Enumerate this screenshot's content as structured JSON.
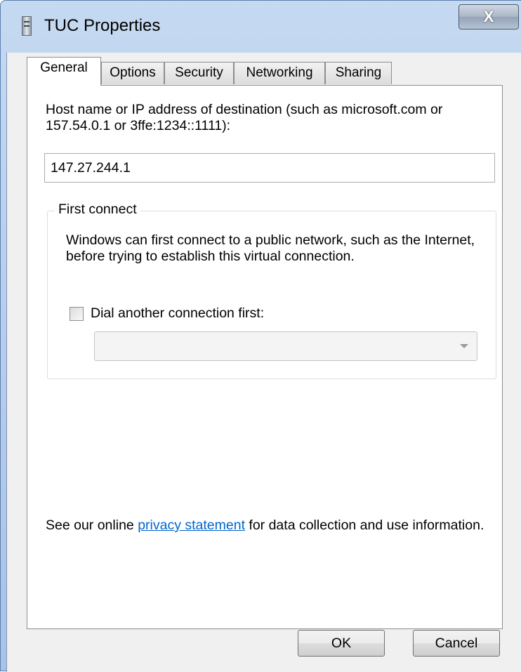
{
  "window": {
    "title": "TUC Properties",
    "close_glyph": "X"
  },
  "tabs": [
    {
      "label": "General",
      "active": true
    },
    {
      "label": "Options",
      "active": false
    },
    {
      "label": "Security",
      "active": false
    },
    {
      "label": "Networking",
      "active": false
    },
    {
      "label": "Sharing",
      "active": false
    }
  ],
  "general": {
    "host_label": "Host name or IP address of destination (such as microsoft.com or 157.54.0.1 or 3ffe:1234::1111):",
    "host_value": "147.27.244.1",
    "first_connect": {
      "title": "First connect",
      "description": "Windows can first connect to a public network, such as the Internet, before trying to establish this virtual connection.",
      "checkbox_label": "Dial another connection first:",
      "checkbox_checked": false,
      "combo_value": ""
    },
    "privacy_prefix": "See our online ",
    "privacy_link": "privacy statement",
    "privacy_suffix": " for data collection and use information."
  },
  "buttons": {
    "ok": "OK",
    "cancel": "Cancel"
  }
}
